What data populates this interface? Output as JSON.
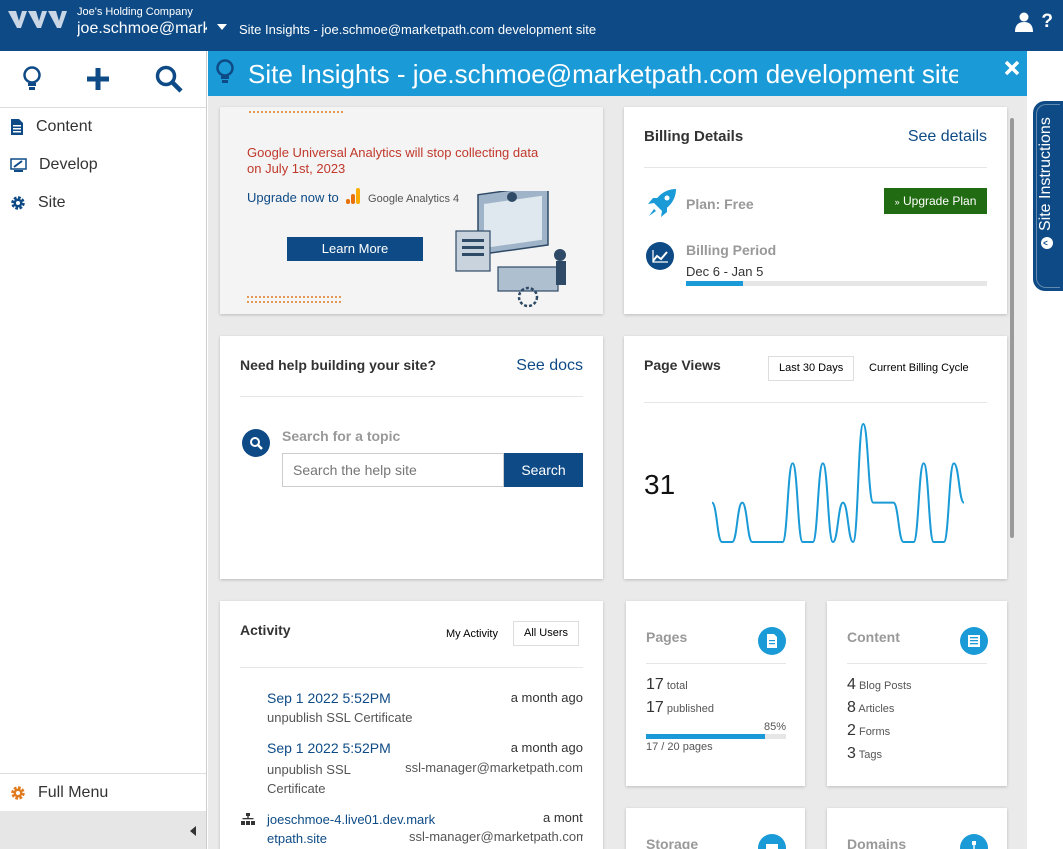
{
  "topbar": {
    "company": "Joe's Holding Company",
    "account": "joe.schmoe@marketpath.com",
    "site": "Site Insights - joe.schmoe@marketpath.com development site"
  },
  "sidebar": {
    "items": [
      {
        "label": "Content",
        "icon": "document-icon"
      },
      {
        "label": "Develop",
        "icon": "develop-icon"
      },
      {
        "label": "Site",
        "icon": "gear-icon"
      }
    ],
    "full_menu": "Full Menu"
  },
  "panel": {
    "title": "Site Insights - joe.schmoe@marketpath.com development site"
  },
  "promo": {
    "line1": "Google Universal Analytics will stop collecting data",
    "line2": "on July 1st, 2023",
    "upgrade": "Upgrade now to",
    "ga_text": "Google Analytics 4",
    "button": "Learn More"
  },
  "billing": {
    "title": "Billing Details",
    "see_details": "See details",
    "plan": "Plan: Free",
    "upgrade_button": "Upgrade Plan",
    "period_label": "Billing Period",
    "period": "Dec 6 - Jan 5",
    "progress": 0.19
  },
  "help": {
    "title": "Need help building your site?",
    "see_docs": "See docs",
    "search_label": "Search for a topic",
    "placeholder": "Search the help site",
    "search_button": "Search"
  },
  "pageviews": {
    "title": "Page Views",
    "tab1": "Last 30 Days",
    "tab2": "Current Billing Cycle",
    "total": "31",
    "series": [
      1,
      0,
      0,
      1,
      0,
      0,
      0,
      0,
      2,
      0,
      0,
      2,
      0,
      1,
      0,
      3,
      1,
      1,
      1,
      0,
      0,
      2,
      0,
      0,
      2,
      1
    ]
  },
  "activity": {
    "title": "Activity",
    "tab1": "My Activity",
    "tab2": "All Users",
    "rows": [
      {
        "date": "Sep 1 2022 5:52PM",
        "ago": "a month ago",
        "desc": "unpublish SSL Certificate",
        "user": ""
      },
      {
        "date": "Sep 1 2022 5:52PM",
        "ago": "a month ago",
        "desc": "unpublish SSL Certificate",
        "user": "ssl-manager@marketpath.com"
      },
      {
        "date": "joeschmoe-4.live01.dev.marketpath.site",
        "ago": "a month ago",
        "desc": "",
        "user": "ssl-manager@marketpath.com"
      }
    ]
  },
  "pages": {
    "title": "Pages",
    "total": "17",
    "total_label": "total",
    "published": "17",
    "published_label": "published",
    "pct": "85%",
    "usage": "17 / 20 pages",
    "progress": 0.85
  },
  "content": {
    "title": "Content",
    "items": [
      {
        "n": "4",
        "label": "Blog Posts"
      },
      {
        "n": "8",
        "label": "Articles"
      },
      {
        "n": "2",
        "label": "Forms"
      },
      {
        "n": "3",
        "label": "Tags"
      }
    ]
  },
  "storage": {
    "title": "Storage"
  },
  "domains": {
    "title": "Domains"
  },
  "right_tab": {
    "label": "Site Instructions"
  }
}
